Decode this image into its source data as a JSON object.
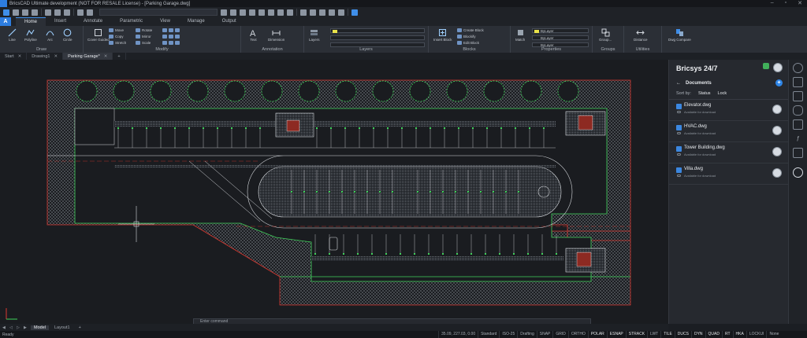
{
  "window": {
    "title": "BricsCAD Ultimate development (NOT FOR RESALE License) - [Parking Garage.dwg]"
  },
  "ribbon": {
    "app_button": "A",
    "tabs": [
      "Home",
      "Insert",
      "Annotate",
      "Parametric",
      "View",
      "Manage",
      "Output"
    ],
    "active_tab": "Home",
    "groups": {
      "draw": {
        "title": "Draw",
        "line": "Line",
        "polyline": "Polyline",
        "arc": "Arc",
        "circle": "Circle"
      },
      "modify": {
        "title": "Modify",
        "cover_guided": "Cover Guided",
        "move": "Move",
        "copy": "Copy",
        "stretch": "Stretch",
        "rotate": "Rotate",
        "mirror": "Mirror",
        "scale": "Scale"
      },
      "annotation": {
        "title": "Annotation",
        "text": "Text",
        "dimension": "Dimension"
      },
      "layers": {
        "title": "Layers",
        "layers_btn": "Layers"
      },
      "blocks": {
        "title": "Blocks",
        "insert_block": "Insert Block",
        "create_block": "Create Block",
        "blockify": "Blockify",
        "edit_block": "Edit Block"
      },
      "properties": {
        "title": "Properties",
        "match": "Match",
        "bylayer_1": "ByLayer",
        "bylayer_2": "ByLayer",
        "bylayer_3": "ByLayer"
      },
      "groups": {
        "title": "Groups",
        "group": "Group..."
      },
      "utilities": {
        "title": "Utilities",
        "distance": "Distance"
      },
      "compare": {
        "title": "Dwg Compare"
      }
    }
  },
  "doc_tabs": [
    {
      "label": "Start",
      "active": false
    },
    {
      "label": "Drawing1",
      "active": false
    },
    {
      "label": "Parking Garage*",
      "active": true
    }
  ],
  "command_line": {
    "placeholder": "Enter command"
  },
  "panel": {
    "title": "Bricsys 24/7",
    "section": "Documents",
    "sort_label": "Sort by:",
    "sort_options": [
      "Status",
      "Lock"
    ],
    "files": [
      {
        "name": "Elevator.dwg",
        "status": "Available for download"
      },
      {
        "name": "HVAC.dwg",
        "status": "Available for download"
      },
      {
        "name": "Tower Building.dwg",
        "status": "Available for download"
      },
      {
        "name": "Villa.dwg",
        "status": "Available for download"
      }
    ]
  },
  "layout_tabs": [
    {
      "label": "Model",
      "active": true
    },
    {
      "label": "Layout1",
      "active": false
    },
    {
      "label": "+",
      "active": false
    }
  ],
  "status_bar": {
    "ready": "Ready",
    "coords": "35.09, 227.03, 0.00",
    "cells": [
      "Standard",
      "ISO-25",
      "Drafting",
      "SNAP",
      "GRID",
      "ORTHO",
      "POLAR",
      "ESNAP",
      "STRACK",
      "LWT",
      "TILE",
      "DUCS",
      "DYN",
      "QUAD",
      "RT",
      "HKA",
      "LOCKUI",
      "None"
    ],
    "on_cells": [
      "POLAR",
      "ESNAP",
      "STRACK",
      "TILE",
      "DUCS",
      "DYN",
      "QUAD",
      "RT",
      "HKA"
    ]
  },
  "colors": {
    "accent": "#2d7de0",
    "layer_yellow": "#e9e24a",
    "cad_green": "#3fd25a",
    "cad_red": "#d9382f",
    "cad_white": "#d8dbdf"
  }
}
